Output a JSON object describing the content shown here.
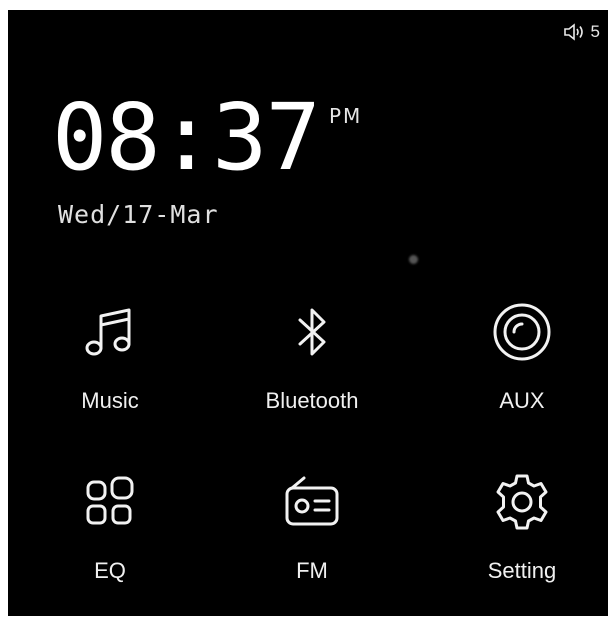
{
  "status": {
    "volume_icon": "speaker-icon",
    "volume_level": "5"
  },
  "clock": {
    "time": "08:37",
    "ampm": "PM",
    "date": "Wed/17-Mar"
  },
  "menu": {
    "items": [
      {
        "label": "Music",
        "icon": "music-note-icon"
      },
      {
        "label": "Bluetooth",
        "icon": "bluetooth-icon"
      },
      {
        "label": "AUX",
        "icon": "aux-icon"
      },
      {
        "label": "EQ",
        "icon": "equalizer-grid-icon"
      },
      {
        "label": "FM",
        "icon": "radio-icon"
      },
      {
        "label": "Setting",
        "icon": "gear-icon"
      }
    ]
  },
  "colors": {
    "background": "#000000",
    "foreground": "#f2f2f2"
  }
}
